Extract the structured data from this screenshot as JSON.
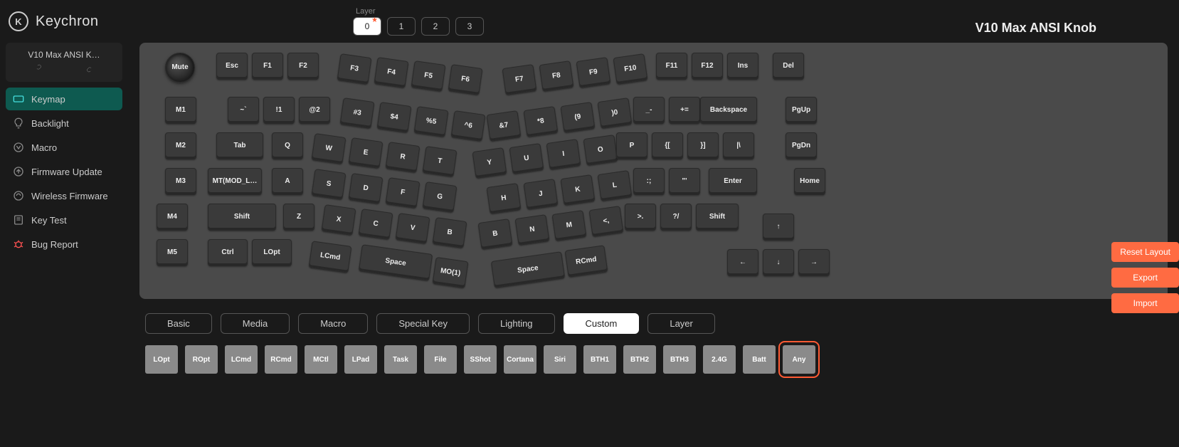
{
  "brand": "Keychron",
  "device": {
    "name": "V10 Max ANSI K…"
  },
  "nav": {
    "keymap": "Keymap",
    "backlight": "Backlight",
    "macro": "Macro",
    "firmware_update": "Firmware Update",
    "wireless_firmware": "Wireless Firmware",
    "key_test": "Key Test",
    "bug_report": "Bug Report"
  },
  "layer": {
    "label": "Layer",
    "items": [
      "0",
      "1",
      "2",
      "3"
    ]
  },
  "title": "V10 Max ANSI Knob",
  "keys": {
    "row0": [
      "Mute",
      "Esc",
      "F1",
      "F2",
      "F3",
      "F4",
      "F5",
      "F6",
      "F7",
      "F8",
      "F9",
      "F10",
      "F11",
      "F12",
      "Ins",
      "Del"
    ],
    "row1": {
      "m": "M1",
      "main": [
        "~\n`",
        "!\n1",
        "@\n2",
        "#\n3",
        "$\n4",
        "%\n5",
        "^\n6",
        "&\n7",
        "*\n8",
        "(\n9",
        ")\n0",
        "_\n-",
        "+\n="
      ],
      "back": "Backspace",
      "side": "PgUp"
    },
    "row2": {
      "m": "M2",
      "tab": "Tab",
      "keys": [
        "Q",
        "W",
        "E",
        "R",
        "T",
        "Y",
        "U",
        "I",
        "O",
        "P",
        "{\n[",
        "}\n]",
        "|\n\\"
      ],
      "side": "PgDn"
    },
    "row3": {
      "m": "M3",
      "caps": "MT(MOD_L…",
      "keys": [
        "A",
        "S",
        "D",
        "F",
        "G",
        "H",
        "J",
        "K",
        "L",
        ":\n;",
        "\"\n'"
      ],
      "enter": "Enter",
      "side": "Home"
    },
    "row4": {
      "m": "M4",
      "lshift": "Shift",
      "keys": [
        "Z",
        "X",
        "C",
        "V",
        "B",
        "B",
        "N",
        "M",
        "<\n,",
        ">\n.",
        "?\n/"
      ],
      "rshift": "Shift",
      "up": "↑"
    },
    "row5": {
      "m": "M5",
      "keys": [
        "Ctrl",
        "LOpt",
        "LCmd",
        "Space",
        "MO(1)",
        "Space",
        "RCmd"
      ],
      "arrows": [
        "←",
        "↓",
        "→"
      ]
    }
  },
  "actions": {
    "reset": "Reset Layout",
    "export": "Export",
    "import": "Import"
  },
  "tabs": [
    "Basic",
    "Media",
    "Macro",
    "Special Key",
    "Lighting",
    "Custom",
    "Layer"
  ],
  "custom_keys": [
    "LOpt",
    "ROpt",
    "LCmd",
    "RCmd",
    "MCtl",
    "LPad",
    "Task",
    "File",
    "SShot",
    "Cortana",
    "Siri",
    "BTH1",
    "BTH2",
    "BTH3",
    "2.4G",
    "Batt",
    "Any"
  ]
}
